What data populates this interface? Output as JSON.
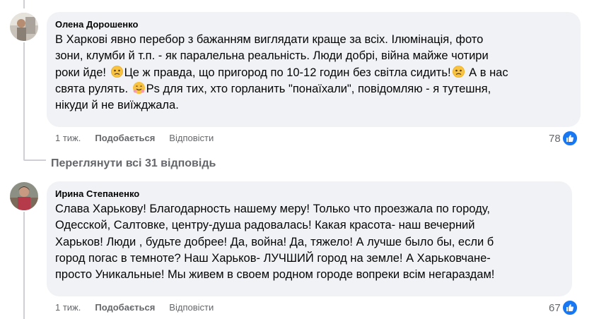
{
  "comments": [
    {
      "author": "Олена Дорошенко",
      "lines": [
        "В Харкові явно перебор з бажанням виглядати краще за всіх. Ілюмінація, фото",
        "зони, клумби й т.п. - як паралельна реальність. Люди добрі, війна майже чотири",
        "роки йде! ",
        "Це ж правда, що пригород по 10-12 годин без світла сидить!",
        " А в нас",
        "свята рулять. ",
        "Ps для тих, хто горланить \"понаїхали\", повідомляю - я тутешня,",
        "нікуди й не виїжджала."
      ],
      "time": "1 тиж.",
      "like_label": "Подобається",
      "reply_label": "Відповісти",
      "reactions": "78"
    },
    {
      "author": "Ирина Степаненко",
      "lines": [
        "Слава Харькову! Благодарность нашему меру! Только что проезжала по городу,",
        "Одесской, Салтовке, центру-душа радовалась! Какая красота- наш вечерний",
        "Харьков! Люди , будьте добрее! Да, война! Да, тяжело! А лучше было бы, если б",
        "город погас в темноте? Наш Харьков- ЛУЧШИЙ город на земле! А Харьковчане-",
        "просто Уникальные! Мы живем в своем родном городе вопреки всім негараздам!"
      ],
      "time": "1 тиж.",
      "like_label": "Подобається",
      "reply_label": "Відповісти",
      "reactions": "67"
    }
  ],
  "view_replies": "Переглянути всі 31 відповідь",
  "colors": {
    "bubble": "#f0f2f5",
    "meta": "#65676b",
    "like_blue": "#1877f2"
  }
}
